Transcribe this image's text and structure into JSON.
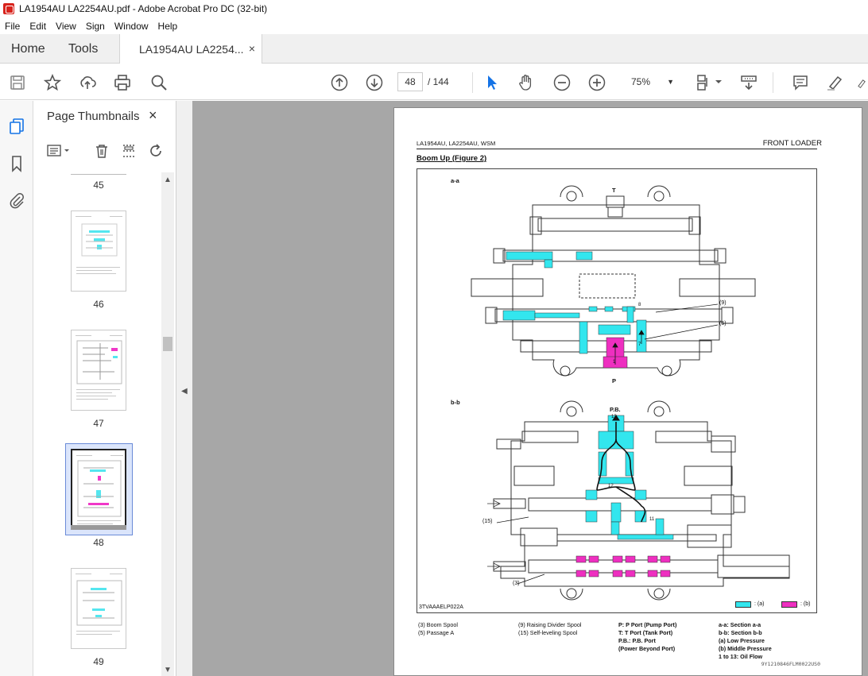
{
  "window": {
    "title": "LA1954AU LA2254AU.pdf - Adobe Acrobat Pro DC (32-bit)"
  },
  "menu": [
    "File",
    "Edit",
    "View",
    "Sign",
    "Window",
    "Help"
  ],
  "tabs": {
    "home": "Home",
    "tools": "Tools",
    "document": "LA1954AU LA2254...",
    "close": "×"
  },
  "toolbar": {
    "page_current": "48",
    "page_total": "/ 144",
    "zoom": "75%",
    "icons": [
      "save-icon",
      "star-icon",
      "upload-icon",
      "print-icon",
      "zoom-search-icon",
      "prev-page-icon",
      "next-page-icon",
      "select-arrow-icon",
      "hand-icon",
      "zoom-out-icon",
      "zoom-in-icon",
      "page-display-icon",
      "scroll-mode-icon",
      "comment-icon",
      "highlight-icon",
      "draw-icon"
    ]
  },
  "sidebar": {
    "title": "Page Thumbnails",
    "close": "×",
    "pages": [
      {
        "num": "45"
      },
      {
        "num": "46"
      },
      {
        "num": "47"
      },
      {
        "num": "48",
        "selected": true
      },
      {
        "num": "49"
      }
    ]
  },
  "document": {
    "header_left": "LA1954AU, LA2254AU, WSM",
    "header_right": "FRONT LOADER",
    "section_title": "Boom Up (Figure 2)",
    "figure": {
      "section_aa": "a-a",
      "section_bb": "b-b",
      "port_T": "T",
      "port_P": "P",
      "port_PB": "P.B.",
      "callout_9": "(9)",
      "callout_5": "(5)",
      "callout_15": "(15)",
      "callout_3": "(3)",
      "flow_8": "8",
      "flow_7": "7",
      "flow_1": "1",
      "flow_13": "13",
      "flow_12": "12",
      "flow_11": "11",
      "figure_code": "3TVAAAELP022A",
      "legend_a": ": (a)",
      "legend_b": ": (b)",
      "legend_a_color": "#33e6ee",
      "legend_b_color": "#ee2fc0"
    },
    "caption": {
      "col1": [
        "(3)   Boom Spool",
        "(5)   Passage A"
      ],
      "col2": [
        "(9)   Raising Divider Spool",
        "(15) Self-leveling Spool"
      ],
      "col3": [
        "P:     P Port (Pump Port)",
        "T:     T Port (Tank Port)",
        "P.B.:  P.B. Port",
        "          (Power Beyond Port)"
      ],
      "col4": [
        "a-a: Section a-a",
        "b-b: Section b-b",
        "(a)   Low Pressure",
        "(b)   Middle Pressure",
        "1 to 13: Oil Flow"
      ]
    },
    "footer_code": "9Y1210846FLM0022US0"
  }
}
